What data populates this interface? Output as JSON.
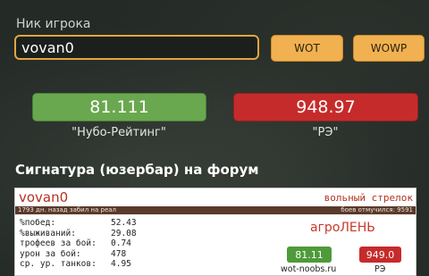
{
  "form": {
    "nick_label": "Ник игрока",
    "nick_value": "vovan0",
    "wot_button": "WOT",
    "wowp_button": "WOWP"
  },
  "ratings": {
    "noob_value": "81.111",
    "noob_caption": "\"Нубо-Рейтинг\"",
    "re_value": "948.97",
    "re_caption": "\"РЭ\""
  },
  "signature_section": {
    "title": "Сигнатура (юзербар) на форум"
  },
  "signature": {
    "name": "vovan0",
    "clan": "вольный стрелок",
    "bar_left": "1793 дн. назад забил на реал",
    "bar_right": "боев отмучился: 9591",
    "stats": [
      {
        "label": "%побед:",
        "value": "52.43"
      },
      {
        "label": "%выживаний:",
        "value": "29.08"
      },
      {
        "label": "трофеев за бой:",
        "value": "0.74"
      },
      {
        "label": "урон за бой:",
        "value": "478"
      },
      {
        "label": "ср. ур. танков:",
        "value": "4.95"
      }
    ],
    "agro": "агроЛЕНЬ",
    "noob_value": "81.11",
    "noob_caption": "wot-noobs.ru",
    "re_value": "949.0",
    "re_caption": "РЭ"
  },
  "colors": {
    "accent_orange": "#f2b150",
    "green": "#6aa84f",
    "red": "#c62b2b"
  }
}
